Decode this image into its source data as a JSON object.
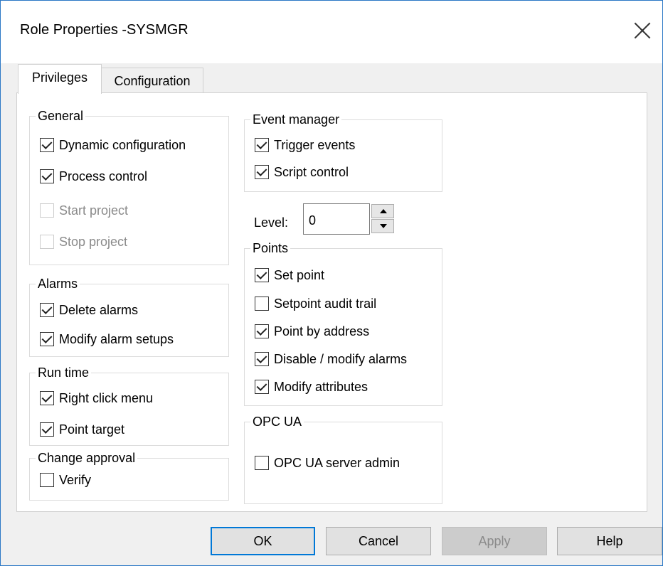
{
  "window": {
    "title": "Role Properties -SYSMGR"
  },
  "tabs": [
    {
      "label": "Privileges",
      "active": true
    },
    {
      "label": "Configuration",
      "active": false
    }
  ],
  "groups": {
    "general": {
      "title": "General",
      "items": [
        {
          "label": "Dynamic configuration",
          "checked": true,
          "enabled": true
        },
        {
          "label": "Process control",
          "checked": true,
          "enabled": true
        },
        {
          "label": "Start project",
          "checked": false,
          "enabled": false
        },
        {
          "label": "Stop project",
          "checked": false,
          "enabled": false
        }
      ]
    },
    "alarms": {
      "title": "Alarms",
      "items": [
        {
          "label": "Delete alarms",
          "checked": true,
          "enabled": true
        },
        {
          "label": "Modify alarm setups",
          "checked": true,
          "enabled": true
        }
      ]
    },
    "runtime": {
      "title": "Run time",
      "items": [
        {
          "label": "Right click menu",
          "checked": true,
          "enabled": true
        },
        {
          "label": "Point target",
          "checked": true,
          "enabled": true
        }
      ]
    },
    "change_approval": {
      "title": "Change approval",
      "items": [
        {
          "label": "Verify",
          "checked": false,
          "enabled": true
        }
      ]
    },
    "event_manager": {
      "title": "Event manager",
      "items": [
        {
          "label": "Trigger events",
          "checked": true,
          "enabled": true
        },
        {
          "label": "Script control",
          "checked": true,
          "enabled": true
        }
      ]
    },
    "points": {
      "title": "Points",
      "items": [
        {
          "label": "Set point",
          "checked": true,
          "enabled": true
        },
        {
          "label": "Setpoint audit trail",
          "checked": false,
          "enabled": true
        },
        {
          "label": "Point by address",
          "checked": true,
          "enabled": true
        },
        {
          "label": "Disable / modify alarms",
          "checked": true,
          "enabled": true
        },
        {
          "label": "Modify attributes",
          "checked": true,
          "enabled": true
        }
      ]
    },
    "opc_ua": {
      "title": "OPC UA",
      "items": [
        {
          "label": "OPC UA server admin",
          "checked": false,
          "enabled": true
        }
      ]
    }
  },
  "level": {
    "label": "Level:",
    "value": "0"
  },
  "buttons": {
    "ok": "OK",
    "cancel": "Cancel",
    "apply": "Apply",
    "help": "Help"
  }
}
